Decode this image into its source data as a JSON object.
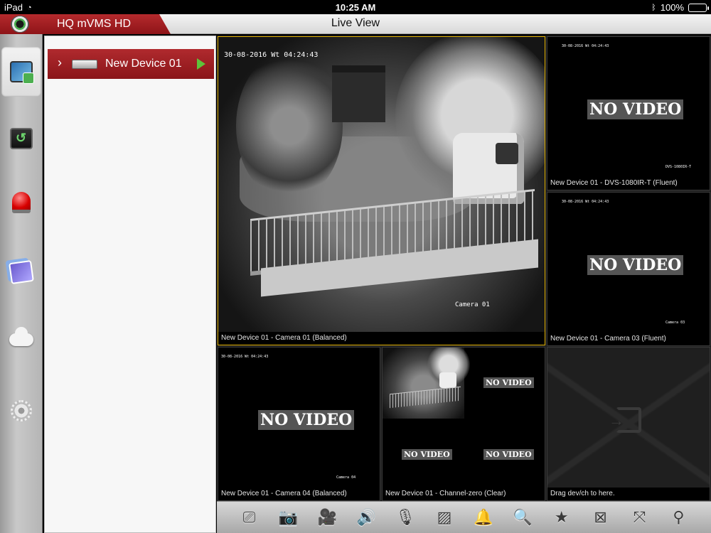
{
  "status_bar": {
    "device": "iPad",
    "time": "10:25 AM",
    "battery": "100%",
    "battery_level": 1.0
  },
  "app": {
    "name": "HQ mVMS HD",
    "page_title": "Live View"
  },
  "rail": [
    {
      "name": "live-view-icon",
      "active": true
    },
    {
      "name": "playback-icon",
      "active": false
    },
    {
      "name": "alarm-icon",
      "active": false
    },
    {
      "name": "media-icon",
      "active": false
    },
    {
      "name": "cloud-icon",
      "active": false
    },
    {
      "name": "settings-icon",
      "active": false
    }
  ],
  "device_list": {
    "items": [
      {
        "name": "New Device 01"
      }
    ]
  },
  "tiles": {
    "t1": {
      "caption": "New Device 01 - Camera 01 (Balanced)",
      "osd_time": "30-08-2016 Wt 04:24:43",
      "osd_cam": "Camera 01"
    },
    "t2": {
      "caption": "New Device 01 - DVS-1080IR-T (Fluent)",
      "no_video": "NO VIDEO"
    },
    "t3": {
      "caption": "New Device 01 - Camera 03 (Fluent)",
      "no_video": "NO VIDEO",
      "osd_cam": "Camera 03"
    },
    "t4": {
      "caption": "New Device 01 - Camera 04 (Balanced)",
      "no_video": "NO VIDEO",
      "osd_time": "30-08-2016 Wt 04:24:43",
      "osd_cam": "Camera 04"
    },
    "t5": {
      "caption": "New Device 01 - Channel-zero (Clear)",
      "no_video": "NO VIDEO"
    },
    "t6": {
      "caption": "Drag dev/ch to here."
    }
  },
  "toolbar": [
    {
      "name": "capture-playback-icon",
      "glyph": "⎚"
    },
    {
      "name": "camera-icon",
      "glyph": "📷"
    },
    {
      "name": "record-icon",
      "glyph": "🎥"
    },
    {
      "name": "speaker-icon",
      "glyph": "🔊"
    },
    {
      "name": "microphone-icon",
      "glyph": "🎙"
    },
    {
      "name": "image-quality-icon",
      "glyph": "▨"
    },
    {
      "name": "ptz-icon",
      "glyph": "🔔"
    },
    {
      "name": "zoom-in-icon",
      "glyph": "🔍"
    },
    {
      "name": "favorite-star-icon",
      "glyph": "★"
    },
    {
      "name": "close-all-icon",
      "glyph": "⊠"
    },
    {
      "name": "fullscreen-icon",
      "glyph": "⤧"
    },
    {
      "name": "location-icon",
      "glyph": "⚲"
    }
  ],
  "colors": {
    "brand_red": "#a11f23",
    "selected_border": "#e0b000",
    "play_green": "#5ec43a",
    "battery_green": "#4cd964"
  }
}
